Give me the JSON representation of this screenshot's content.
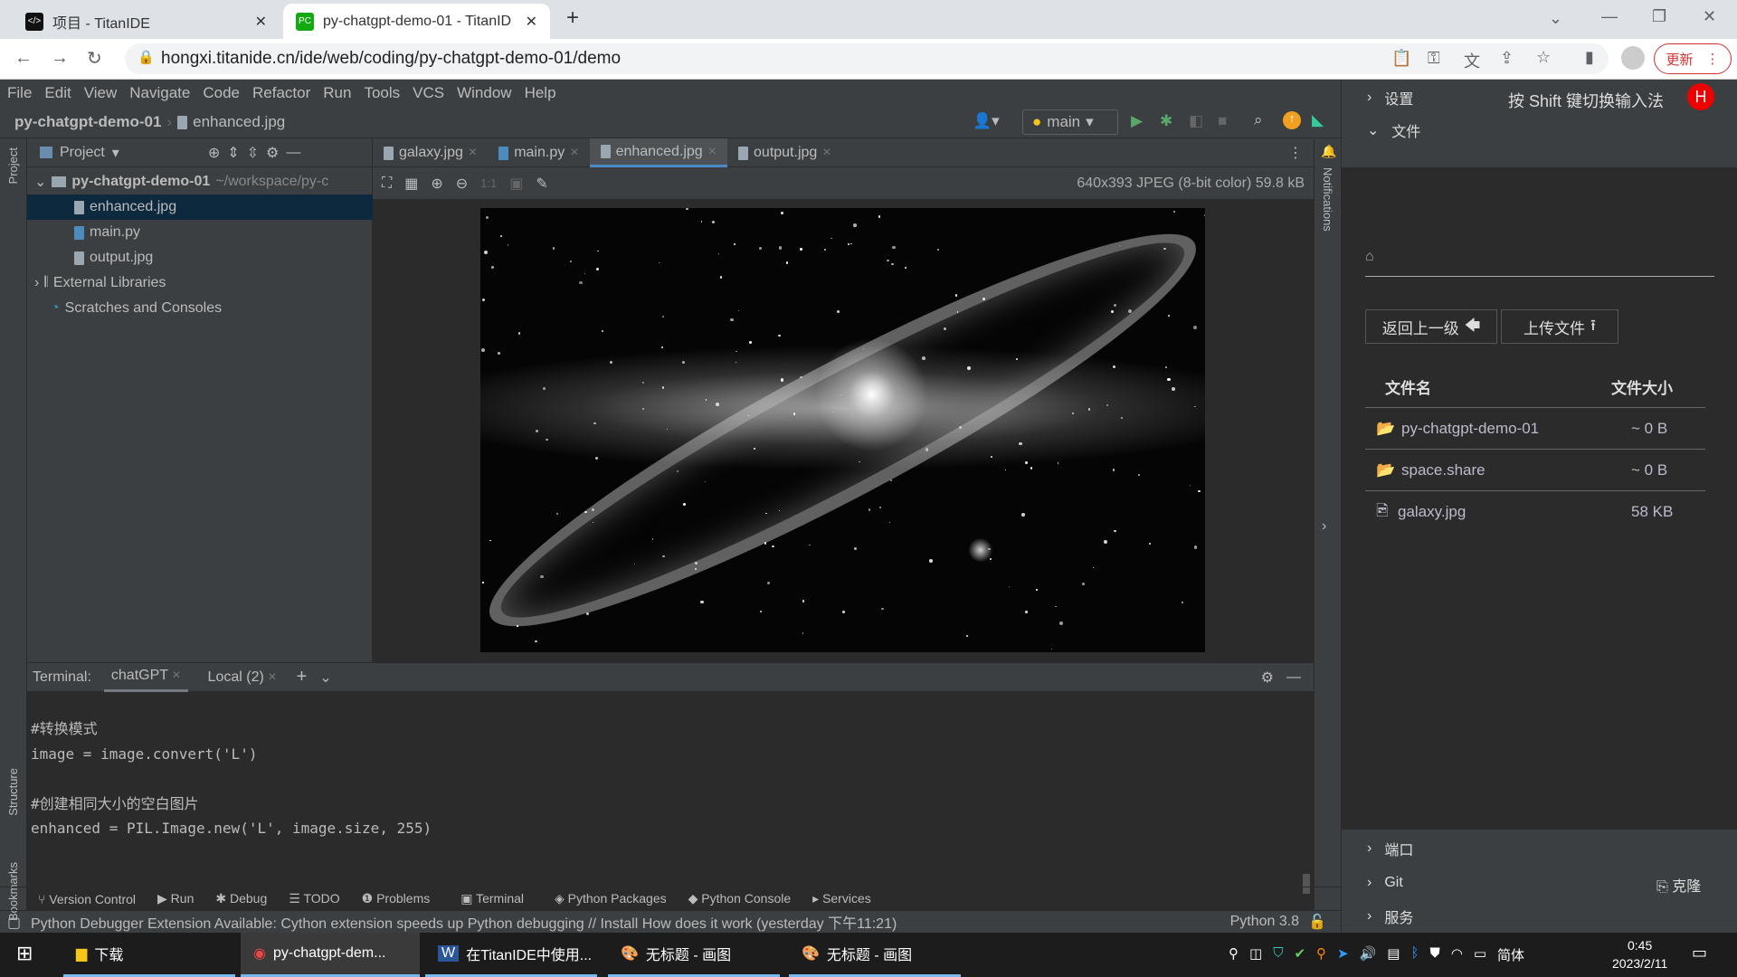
{
  "browser": {
    "tabs": [
      {
        "title": "项目 - TitanIDE"
      },
      {
        "title": "py-chatgpt-demo-01 - TitanID"
      }
    ],
    "url": "hongxi.titanide.cn/ide/web/coding/py-chatgpt-demo-01/demo",
    "update_label": "更新"
  },
  "menu": [
    "File",
    "Edit",
    "View",
    "Navigate",
    "Code",
    "Refactor",
    "Run",
    "Tools",
    "VCS",
    "Window",
    "Help"
  ],
  "breadcrumb": {
    "project": "py-chatgpt-demo-01",
    "file": "enhanced.jpg"
  },
  "toolbar": {
    "run_config": "main"
  },
  "project_panel": {
    "title": "Project",
    "root": "py-chatgpt-demo-01",
    "root_path": "~/workspace/py-c",
    "files": [
      "enhanced.jpg",
      "main.py",
      "output.jpg"
    ],
    "external": "External Libraries",
    "scratches": "Scratches and Consoles"
  },
  "side_labels": {
    "project": "Project",
    "structure": "Structure",
    "bookmarks": "Bookmarks",
    "notifications": "Notifications"
  },
  "editor": {
    "tabs": [
      "galaxy.jpg",
      "main.py",
      "enhanced.jpg",
      "output.jpg"
    ],
    "active_tab": "enhanced.jpg",
    "image_info": "640x393 JPEG (8-bit color) 59.8 kB",
    "zoom_1to1": "1:1"
  },
  "terminal": {
    "label": "Terminal:",
    "tabs": [
      "chatGPT",
      "Local (2)"
    ],
    "lines": [
      "#转换模式",
      "image = image.convert('L')",
      "",
      "#创建相同大小的空白图片",
      "enhanced = PIL.Image.new('L', image.size, 255)"
    ]
  },
  "tool_tabs": [
    "Version Control",
    "Run",
    "Debug",
    "TODO",
    "Problems",
    "Terminal",
    "Python Packages",
    "Python Console",
    "Services"
  ],
  "status": {
    "message": "Python Debugger Extension Available: Cython extension speeds up Python debugging // Install   How does it work (yesterday 下午11:21)",
    "interpreter": "Python 3.8"
  },
  "right_panel": {
    "settings": "设置",
    "ime_hint": "按 Shift 键切换输入法",
    "avatar": "H",
    "files": "文件",
    "back_button": "返回上一级",
    "upload_button": "上传文件",
    "col_name": "文件名",
    "col_size": "文件大小",
    "rows": [
      {
        "name": "py-chatgpt-demo-01",
        "size": "~ 0 B",
        "type": "folder"
      },
      {
        "name": "space.share",
        "size": "~ 0 B",
        "type": "folder"
      },
      {
        "name": "galaxy.jpg",
        "size": "58 KB",
        "type": "image"
      }
    ],
    "ports": "端口",
    "git": "Git",
    "clone": "克隆",
    "services": "服务"
  },
  "taskbar": {
    "items": [
      "下载",
      "py-chatgpt-dem...",
      "在TitanIDE中使用...",
      "无标题 - 画图",
      "无标题 - 画图"
    ],
    "ime": "简体",
    "time": "0:45",
    "date": "2023/2/11"
  }
}
